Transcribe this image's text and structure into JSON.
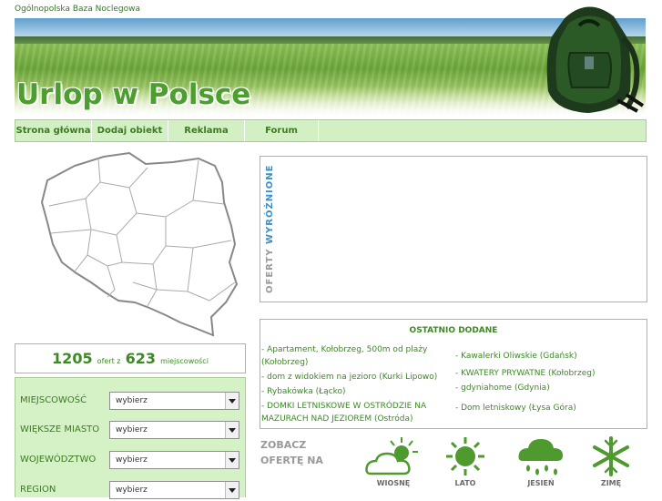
{
  "header": {
    "tagline": "Ogólnopolska Baza Noclegowa",
    "title": "Urlop w Polsce"
  },
  "nav": {
    "items": [
      {
        "label": "Strona główna"
      },
      {
        "label": "Dodaj obiekt"
      },
      {
        "label": "Reklama"
      },
      {
        "label": "Forum"
      }
    ]
  },
  "counter": {
    "offers": "1205",
    "mid": "ofert z",
    "places": "623",
    "tail": "miejscowości"
  },
  "search": {
    "fields": [
      {
        "label": "MIEJSCOWOŚĆ",
        "value": "wybierz"
      },
      {
        "label": "WIĘKSZE MIASTO",
        "value": "wybierz"
      },
      {
        "label": "WOJEWÓDZTWO",
        "value": "wybierz"
      },
      {
        "label": "REGION",
        "value": "wybierz"
      }
    ]
  },
  "featured": {
    "label_grey": "OFERTY",
    "label_blue": "WYRÓŻNIONE"
  },
  "recent": {
    "title": "OSTATNIO DODANE",
    "left": [
      " - Apartament, Kołobrzeg, 500m od plaży (Kołobrzeg)",
      " - dom z widokiem na jezioro (Kurki Lipowo)",
      " - Rybakówka (Łącko)",
      " - DOMKI LETNISKOWE W OSTRÓDZIE NA MAZURACH NAD JEZIOREM (Ostróda)"
    ],
    "right": [
      " - Kawalerki Oliwskie (Gdańsk)",
      " - KWATERY PRYWATNE (Kołobrzeg)",
      " - gdyniahome (Gdynia)",
      " - Dom letniskowy (Łysa Góra)"
    ]
  },
  "see_offer": {
    "line1": "ZOBACZ",
    "line2": "OFERTĘ NA"
  },
  "seasons": [
    {
      "label": "WIOSNĘ",
      "icon": "sun-cloud-icon"
    },
    {
      "label": "LATO",
      "icon": "sun-icon"
    },
    {
      "label": "JESIEŃ",
      "icon": "rain-cloud-icon"
    },
    {
      "label": "ZIMĘ",
      "icon": "snowflake-icon"
    }
  ],
  "colors": {
    "accent_green": "#3b8a22",
    "nav_bg": "#d3f0c5",
    "title_green": "#4c9f2e",
    "featured_blue": "#3e8fc7",
    "icon_green": "#4f9a2f"
  }
}
